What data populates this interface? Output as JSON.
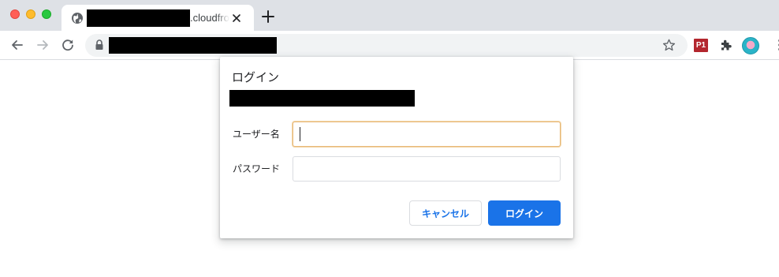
{
  "browser": {
    "tab": {
      "title": ".cloudfront.net",
      "favicon": "globe-icon",
      "close_icon": "close-icon"
    },
    "new_tab_icon": "plus-icon",
    "toolbar": {
      "back_icon": "arrow-left-icon",
      "forward_icon": "arrow-right-icon",
      "reload_icon": "reload-icon",
      "lock_icon": "lock-icon",
      "bookmark_icon": "star-icon",
      "extension_p1_label": "P1",
      "extensions_icon": "puzzle-icon",
      "profile_icon": "avatar",
      "menu_icon": "kebab-menu-icon"
    }
  },
  "dialog": {
    "title": "ログイン",
    "username_label": "ユーザー名",
    "username_value": "",
    "password_label": "パスワード",
    "password_value": "",
    "cancel_label": "キャンセル",
    "login_label": "ログイン"
  },
  "colors": {
    "primary_button": "#1a73e8",
    "focus_border": "#e8b878",
    "tabstrip_bg": "#dee1e6"
  }
}
